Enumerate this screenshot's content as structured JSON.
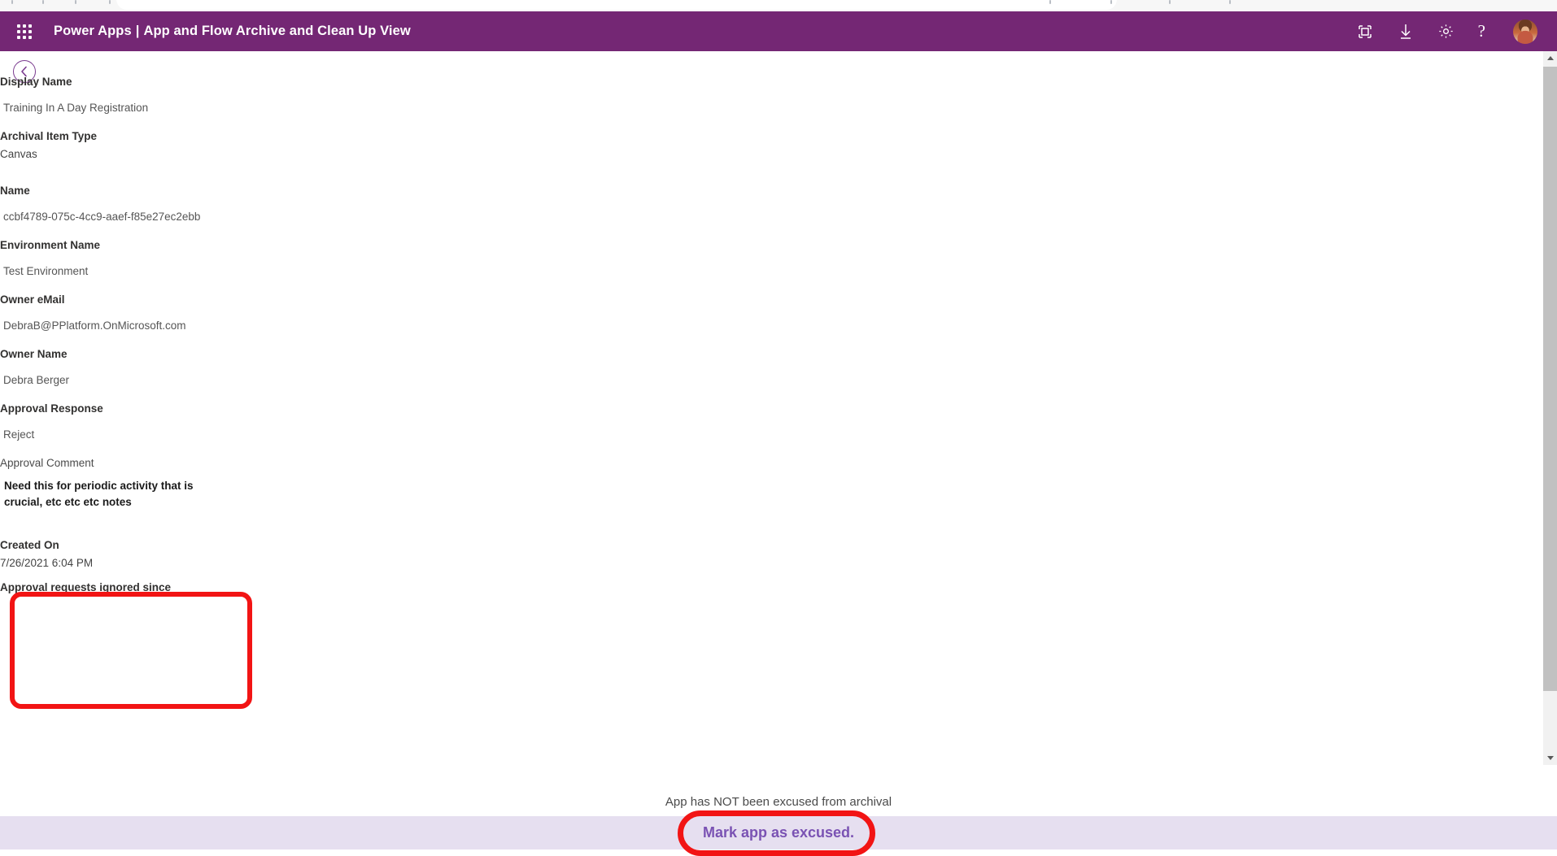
{
  "browser": {
    "omnibox_visible": true
  },
  "appbar": {
    "waffle_icon": "waffle-grid-icon",
    "product": "Power Apps",
    "separator": "|",
    "app_title": "App and Flow Archive and Clean Up View",
    "background_color": "#742774",
    "actions": [
      {
        "name": "fit-to-screen-icon",
        "label": "Fit to screen"
      },
      {
        "name": "download-icon",
        "label": "Download"
      },
      {
        "name": "settings-gear-icon",
        "label": "Settings"
      },
      {
        "name": "help-icon",
        "label": "?"
      }
    ],
    "avatar_label": "Account manager"
  },
  "page": {
    "back_button_label": "Back"
  },
  "form": {
    "fields": [
      {
        "label": "Display Name",
        "value": "Training In A Day Registration",
        "label_style": "bold",
        "value_style": "indent"
      },
      {
        "label": "Archival Item Type",
        "value": "Canvas",
        "label_style": "bold",
        "value_style": "flush"
      },
      {
        "label": "Name",
        "value": "ccbf4789-075c-4cc9-aaef-f85e27ec2ebb",
        "label_style": "bold",
        "value_style": "indent"
      },
      {
        "label": "Environment Name",
        "value": "Test Environment",
        "label_style": "bold",
        "value_style": "indent"
      },
      {
        "label": "Owner eMail",
        "value": "DebraB@PPlatform.OnMicrosoft.com",
        "label_style": "bold",
        "value_style": "indent"
      },
      {
        "label": "Owner Name",
        "value": "Debra Berger",
        "label_style": "bold",
        "value_style": "indent"
      },
      {
        "label": "Approval Response",
        "value": "Reject",
        "label_style": "bold",
        "value_style": "indent"
      },
      {
        "label": "Approval Comment",
        "value": "Need this for periodic activity that is\ncrucial, etc etc etc notes",
        "label_style": "soft",
        "value_style": "strong"
      },
      {
        "label": "Created On",
        "value": "7/26/2021 6:04 PM",
        "label_style": "bold",
        "value_style": "flush"
      },
      {
        "label": "Approval requests ignored since",
        "value": "",
        "label_style": "bold",
        "value_style": "flush"
      }
    ]
  },
  "footer": {
    "status_text": "App has NOT been excused from archival",
    "button_label": "Mark app as excused.",
    "band_color": "#e6dff0",
    "button_text_color": "#7a52b3"
  },
  "annotations": {
    "color": "#f21414",
    "items": [
      {
        "name": "annotation-approval-comment",
        "shape": "rounded-rect"
      },
      {
        "name": "annotation-mark-excused-button",
        "shape": "rounded-rect"
      }
    ]
  },
  "scrollbar": {
    "up_arrow": "scroll-up-arrow",
    "down_arrow": "scroll-down-arrow",
    "thumb": "scroll-thumb"
  }
}
